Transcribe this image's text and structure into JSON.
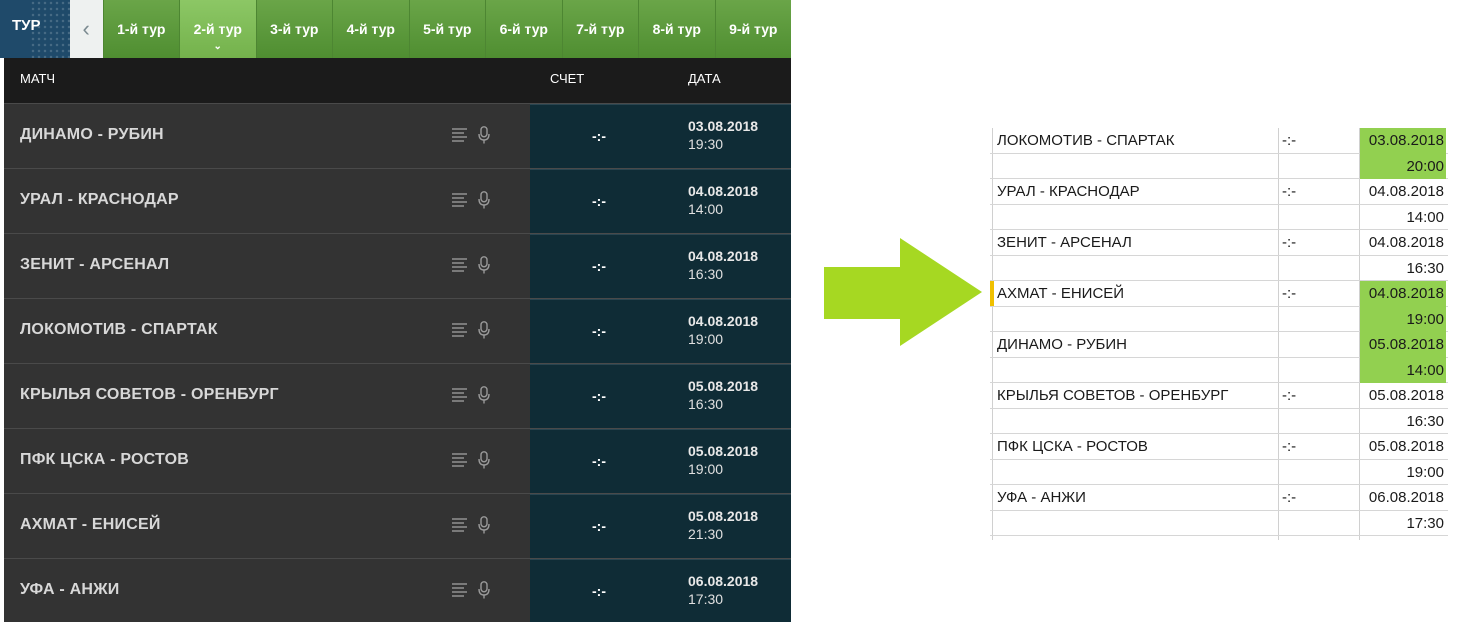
{
  "tour_bar": {
    "label": "ТУР",
    "prev": "‹",
    "tabs": [
      "1-й тур",
      "2-й тур",
      "3-й тур",
      "4-й тур",
      "5-й тур",
      "6-й тур",
      "7-й тур",
      "8-й тур",
      "9-й тур"
    ],
    "active_index": 1
  },
  "table": {
    "headers": {
      "match": "МАТЧ",
      "score": "СЧЕТ",
      "date": "ДАТА"
    },
    "rows": [
      {
        "match": "ДИНАМО - РУБИН",
        "score": "-:-",
        "date": "03.08.2018",
        "time": "19:30"
      },
      {
        "match": "УРАЛ - КРАСНОДАР",
        "score": "-:-",
        "date": "04.08.2018",
        "time": "14:00"
      },
      {
        "match": "ЗЕНИТ - АРСЕНАЛ",
        "score": "-:-",
        "date": "04.08.2018",
        "time": "16:30"
      },
      {
        "match": "ЛОКОМОТИВ - СПАРТАК",
        "score": "-:-",
        "date": "04.08.2018",
        "time": "19:00"
      },
      {
        "match": "КРЫЛЬЯ СОВЕТОВ - ОРЕНБУРГ",
        "score": "-:-",
        "date": "05.08.2018",
        "time": "16:30"
      },
      {
        "match": "ПФК ЦСКА - РОСТОВ",
        "score": "-:-",
        "date": "05.08.2018",
        "time": "19:00"
      },
      {
        "match": "АХМАТ - ЕНИСЕЙ",
        "score": "-:-",
        "date": "05.08.2018",
        "time": "21:30"
      },
      {
        "match": "УФА - АНЖИ",
        "score": "-:-",
        "date": "06.08.2018",
        "time": "17:30"
      }
    ]
  },
  "arrow_color": "#a6d822",
  "sheet": {
    "highlight_color": "#92d050",
    "rows": [
      {
        "match": "ЛОКОМОТИВ - СПАРТАК",
        "score": "-:-",
        "date": "03.08.2018",
        "time": "20:00",
        "highlight": true
      },
      {
        "match": "УРАЛ - КРАСНОДАР",
        "score": "-:-",
        "date": "04.08.2018",
        "time": "14:00",
        "highlight": false
      },
      {
        "match": "ЗЕНИТ - АРСЕНАЛ",
        "score": "-:-",
        "date": "04.08.2018",
        "time": "16:30",
        "highlight": false
      },
      {
        "match": "АХМАТ - ЕНИСЕЙ",
        "score": "-:-",
        "date": "04.08.2018",
        "time": "19:00",
        "highlight": true
      },
      {
        "match": "ДИНАМО - РУБИН",
        "score": "",
        "date": "05.08.2018",
        "time": "14:00",
        "highlight": true
      },
      {
        "match": "КРЫЛЬЯ СОВЕТОВ - ОРЕНБУРГ",
        "score": "-:-",
        "date": "05.08.2018",
        "time": "16:30",
        "highlight": false
      },
      {
        "match": "ПФК ЦСКА - РОСТОВ",
        "score": "-:-",
        "date": "05.08.2018",
        "time": "19:00",
        "highlight": false
      },
      {
        "match": "УФА - АНЖИ",
        "score": "-:-",
        "date": "06.08.2018",
        "time": "17:30",
        "highlight": false
      }
    ]
  }
}
